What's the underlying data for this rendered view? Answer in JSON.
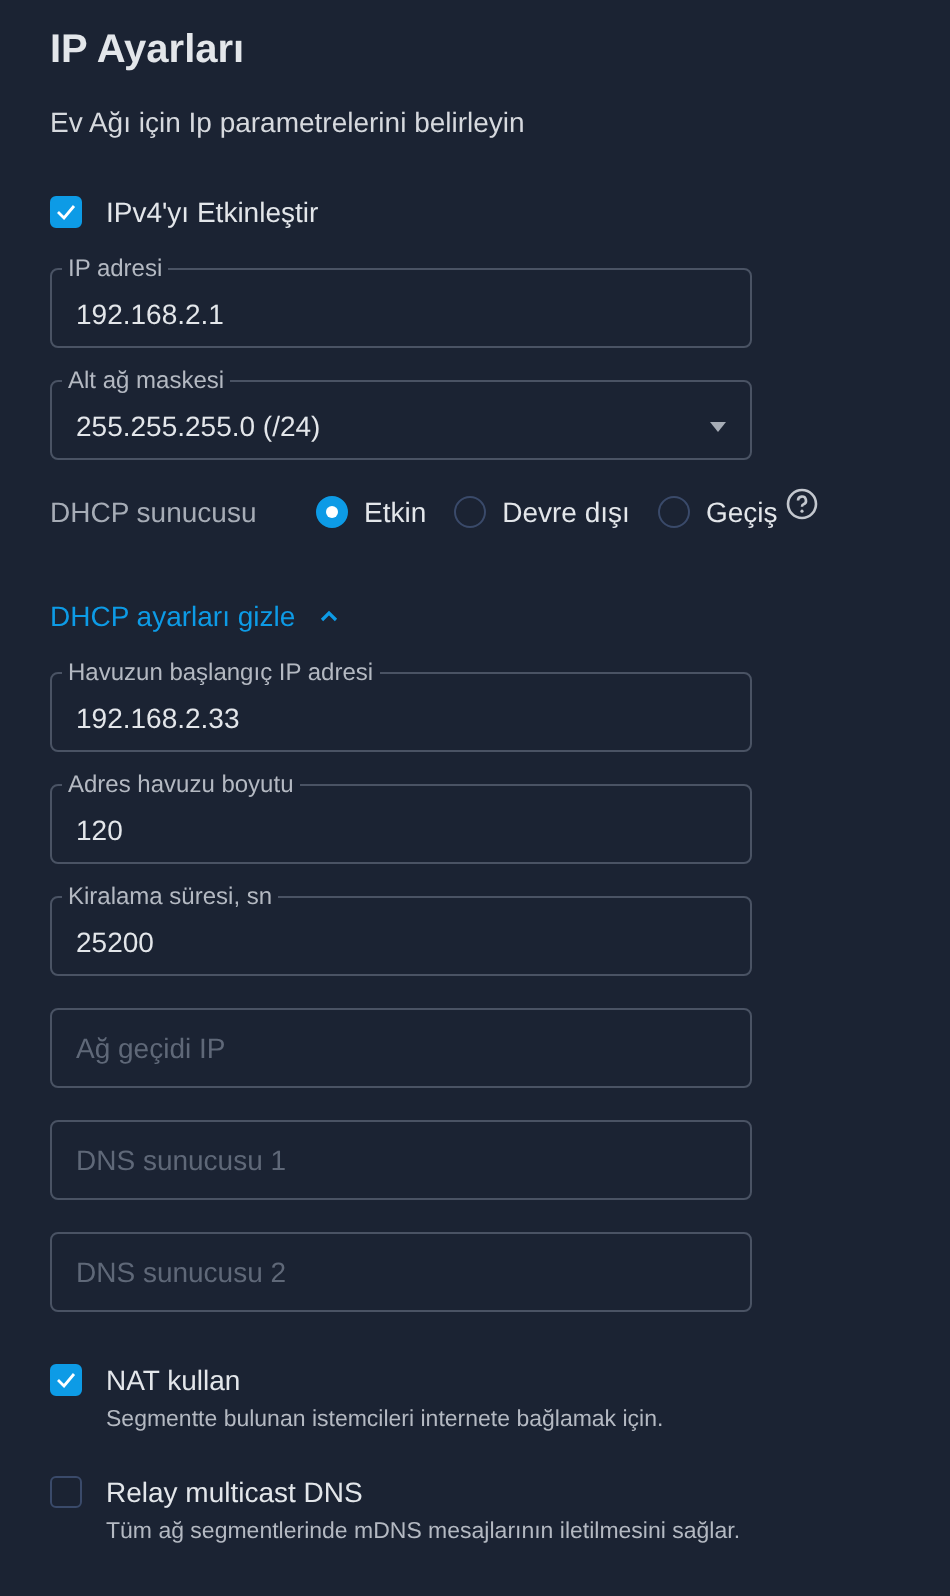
{
  "title": "IP Ayarları",
  "subtitle": "Ev Ağı için Ip parametrelerini belirleyin",
  "enable_ipv4": {
    "label": "IPv4'yı Etkinleştir",
    "checked": true
  },
  "fields": [
    {
      "kind": "text",
      "label": "IP adresi",
      "value": "192.168.2.1"
    },
    {
      "kind": "select",
      "label": "Alt ağ maskesi",
      "value": "255.255.255.0 (/24)"
    }
  ],
  "dhcp": {
    "label": "DHCP sunucusu",
    "options": [
      {
        "label": "Etkin",
        "selected": true
      },
      {
        "label": "Devre dışı",
        "selected": false
      },
      {
        "label": "Geçiş",
        "selected": false,
        "help": true
      }
    ]
  },
  "toggle_link": {
    "label": "DHCP ayarları gizle",
    "expanded": true
  },
  "dhcp_fields": [
    {
      "kind": "text",
      "label": "Havuzun başlangıç IP adresi",
      "value": "192.168.2.33"
    },
    {
      "kind": "text",
      "label": "Adres havuzu boyutu",
      "value": "120"
    },
    {
      "kind": "text",
      "label": "Kiralama süresi, sn",
      "value": "25200"
    },
    {
      "kind": "text",
      "placeholder": "Ağ geçidi IP"
    },
    {
      "kind": "text",
      "placeholder": "DNS sunucusu 1"
    },
    {
      "kind": "text",
      "placeholder": "DNS sunucusu 2"
    }
  ],
  "options": [
    {
      "label": "NAT kullan",
      "description": "Segmentte bulunan istemcileri internete bağlamak için.",
      "checked": true
    },
    {
      "label": "Relay multicast DNS",
      "description": "Tüm ağ segmentlerinde mDNS mesajlarının iletilmesini sağlar.",
      "checked": false
    }
  ]
}
